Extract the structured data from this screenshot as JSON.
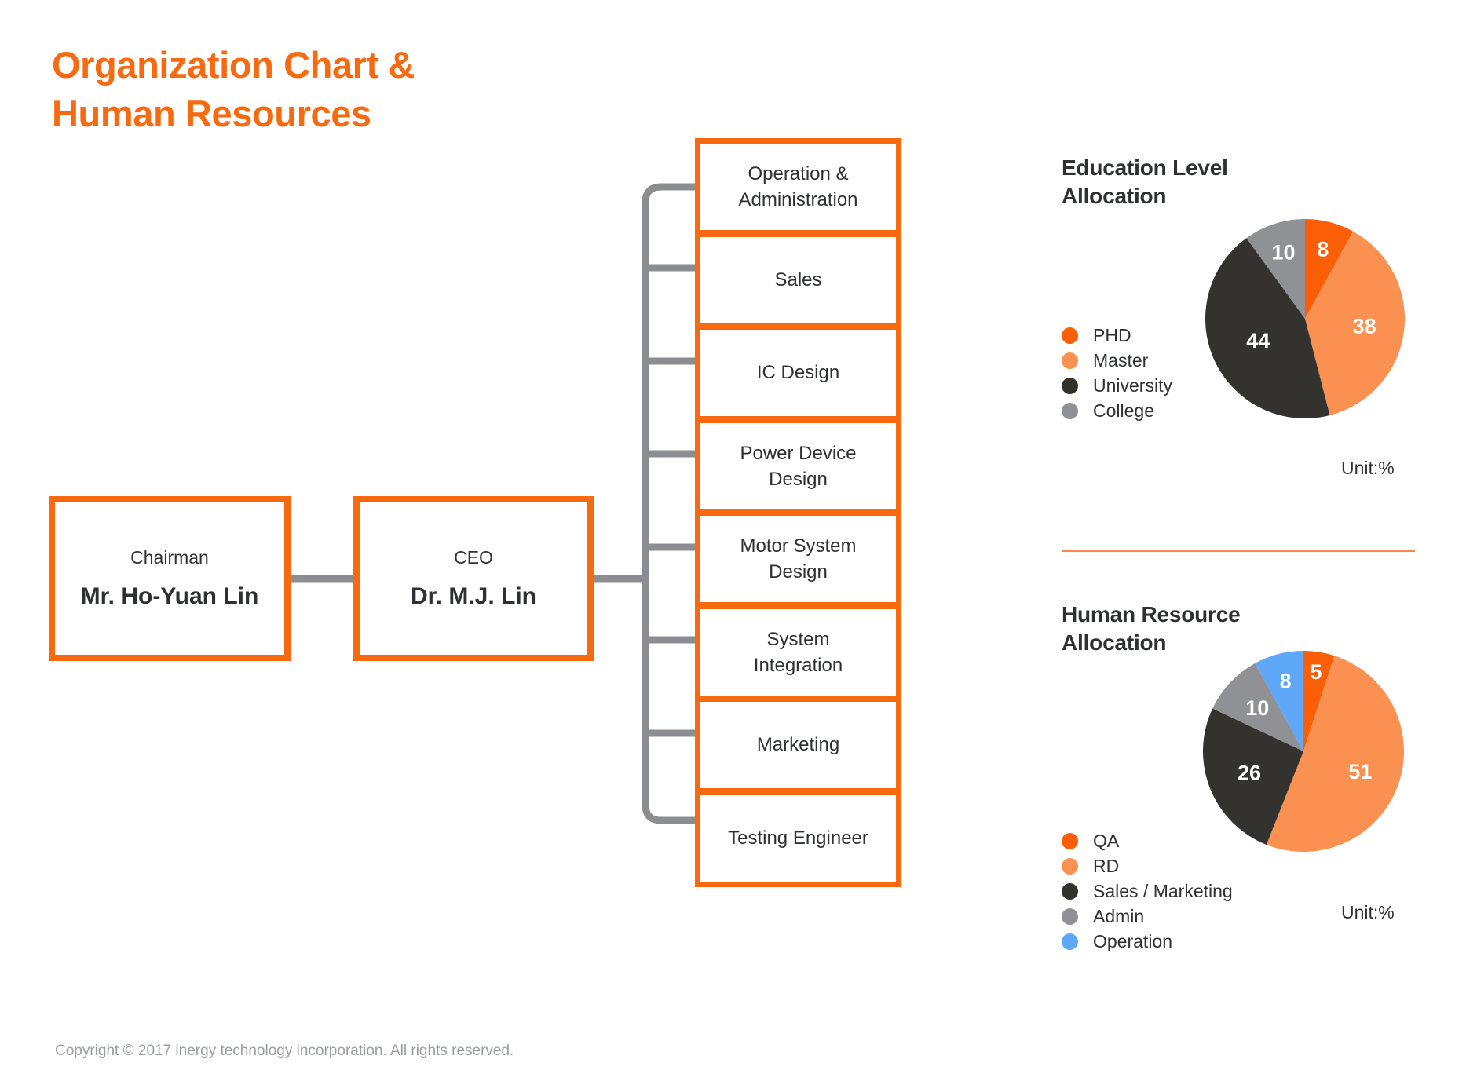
{
  "page": {
    "title": "Organization Chart &\nHuman Resources",
    "title_color": "#f96a10",
    "footer": "Copyright © 2017 inergy technology incorporation. All rights reserved."
  },
  "org_chart": {
    "executives": [
      {
        "role": "Chairman",
        "person": "Mr. Ho-Yuan Lin"
      },
      {
        "role": "CEO",
        "person": "Dr. M.J. Lin"
      }
    ],
    "departments": [
      {
        "label": "Operation &\nAdministration"
      },
      {
        "label": "Sales"
      },
      {
        "label": "IC Design"
      },
      {
        "label": "Power Device\nDesign"
      },
      {
        "label": "Motor System\nDesign"
      },
      {
        "label": "System\nIntegration"
      },
      {
        "label": "Marketing"
      },
      {
        "label": "Testing Engineer"
      }
    ],
    "box_border_color": "#f96a10",
    "connector_color": "#8b8d90"
  },
  "charts": {
    "education": {
      "title": "Education Level\nAllocation",
      "unit": "Unit:%"
    },
    "human_resource": {
      "title": "Human Resource\nAllocation",
      "unit": "Unit:%"
    }
  },
  "chart_data": [
    {
      "type": "pie",
      "title": "Education Level Allocation",
      "unit": "%",
      "legend_position": "left",
      "categories": [
        "PHD",
        "Master",
        "University",
        "College"
      ],
      "values": [
        8,
        38,
        44,
        10
      ],
      "colors": [
        "#fa5f07",
        "#fb9150",
        "#34322f",
        "#8f9194"
      ],
      "labels": [
        "8",
        "38",
        "44",
        "10"
      ],
      "start_angle": 0,
      "direction": "clockwise"
    },
    {
      "type": "pie",
      "title": "Human Resource Allocation",
      "unit": "%",
      "legend_position": "left",
      "categories": [
        "QA",
        "RD",
        "Sales / Marketing",
        "Admin",
        "Operation"
      ],
      "values": [
        5,
        51,
        26,
        10,
        8
      ],
      "colors": [
        "#fa5f07",
        "#fb9150",
        "#34322f",
        "#8f9194",
        "#5fa8f7"
      ],
      "labels": [
        "5",
        "51",
        "26",
        "10",
        "8"
      ],
      "start_angle": 0,
      "direction": "clockwise"
    }
  ]
}
